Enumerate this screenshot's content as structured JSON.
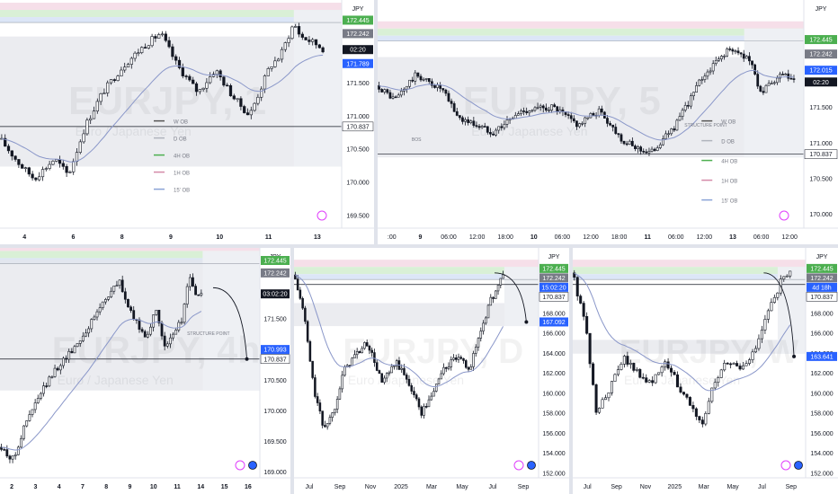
{
  "colors": {
    "up": "#131722",
    "down": "#131722",
    "ema": "#8a97c9",
    "zone": "#e4e6eb",
    "green_band": "#d9f0d6",
    "blue_band": "#dce6f7",
    "pink_band": "#f6dfe9",
    "price_green": "#4caf50",
    "price_gray": "#787b86",
    "price_blue": "#2962ff",
    "price_black": "#131722"
  },
  "panes": [
    {
      "id": "pane-top-left",
      "chart_data": {
        "type": "candlestick",
        "symbol": "JPY",
        "watermark_symbol": "EURJPY, 1",
        "watermark_name": "Euro / Japanese Yen",
        "ylim": [
          169.3,
          172.75
        ],
        "y_ticks": [
          "169.500",
          "170.000",
          "170.500",
          "171.000",
          "171.500"
        ],
        "x_ticks": [
          "4",
          "6",
          "8",
          "9",
          "10",
          "11",
          "13"
        ],
        "price_labels": [
          {
            "text": "172.445",
            "value": 172.445,
            "kind": "green"
          },
          {
            "text": "172.242",
            "value": 172.242,
            "kind": "gray"
          },
          {
            "text": "02:20",
            "value": 172.0,
            "kind": "black"
          },
          {
            "text": "171.789",
            "value": 171.789,
            "kind": "blue"
          },
          {
            "text": "170.837",
            "value": 170.837,
            "kind": "white"
          }
        ],
        "legend": [
          "W OB",
          "D OB",
          "4H OB",
          "1H OB",
          "15' OB"
        ],
        "path": [
          [
            0,
            170.65
          ],
          [
            0.06,
            170.25
          ],
          [
            0.1,
            170.05
          ],
          [
            0.16,
            170.35
          ],
          [
            0.2,
            170.1
          ],
          [
            0.25,
            170.85
          ],
          [
            0.3,
            171.35
          ],
          [
            0.36,
            171.75
          ],
          [
            0.42,
            172.05
          ],
          [
            0.47,
            172.25
          ],
          [
            0.52,
            171.75
          ],
          [
            0.58,
            171.35
          ],
          [
            0.63,
            171.7
          ],
          [
            0.68,
            171.3
          ],
          [
            0.73,
            171.0
          ],
          [
            0.79,
            171.75
          ],
          [
            0.82,
            171.9
          ],
          [
            0.86,
            172.4
          ],
          [
            0.88,
            172.2
          ],
          [
            0.92,
            172.1
          ],
          [
            0.95,
            172.0
          ]
        ]
      }
    },
    {
      "id": "pane-top-right",
      "chart_data": {
        "type": "candlestick",
        "symbol": "JPY",
        "watermark_symbol": "EURJPY, 5",
        "watermark_name": "Euro / Japanese Yen",
        "ylim": [
          169.8,
          173.0
        ],
        "y_ticks": [
          "170.000",
          "170.500",
          "171.000",
          "171.500"
        ],
        "x_ticks": [
          ":00",
          "9",
          "06:00",
          "12:00",
          "18:00",
          "10",
          "06:00",
          "12:00",
          "18:00",
          "11",
          "06:00",
          "12:00",
          "13",
          "06:00",
          "12:00"
        ],
        "price_labels": [
          {
            "text": "172.445",
            "value": 172.445,
            "kind": "green"
          },
          {
            "text": "172.242",
            "value": 172.242,
            "kind": "gray"
          },
          {
            "text": "172.015",
            "value": 172.015,
            "kind": "blue"
          },
          {
            "text": "02:20",
            "value": 171.85,
            "kind": "black"
          },
          {
            "text": "170.837",
            "value": 170.837,
            "kind": "white"
          }
        ],
        "legend": [
          "W OB",
          "D OB",
          "4H OB",
          "1H OB",
          "15' OB"
        ],
        "annotations": [
          "BOS",
          "STRUCTURE POINT"
        ],
        "path": [
          [
            0,
            171.8
          ],
          [
            0.04,
            171.6
          ],
          [
            0.09,
            171.95
          ],
          [
            0.15,
            171.75
          ],
          [
            0.19,
            171.35
          ],
          [
            0.27,
            171.15
          ],
          [
            0.34,
            171.45
          ],
          [
            0.41,
            171.5
          ],
          [
            0.47,
            171.25
          ],
          [
            0.52,
            171.45
          ],
          [
            0.58,
            171.0
          ],
          [
            0.64,
            170.85
          ],
          [
            0.7,
            171.25
          ],
          [
            0.76,
            171.9
          ],
          [
            0.82,
            172.3
          ],
          [
            0.87,
            172.2
          ],
          [
            0.9,
            171.7
          ],
          [
            0.95,
            171.95
          ],
          [
            0.98,
            171.85
          ]
        ]
      }
    },
    {
      "id": "pane-bottom-left",
      "chart_data": {
        "type": "candlestick",
        "symbol": "JPY",
        "watermark_symbol": "EURJPY, 4h",
        "watermark_name": "Euro / Japanese Yen",
        "ylim": [
          168.9,
          172.65
        ],
        "y_ticks": [
          "169.000",
          "169.500",
          "170.000",
          "170.500",
          "171.000",
          "171.500"
        ],
        "x_ticks": [
          "2",
          "3",
          "4",
          "7",
          "8",
          "9",
          "10",
          "11",
          "14",
          "15",
          "16"
        ],
        "price_labels": [
          {
            "text": "172.445",
            "value": 172.445,
            "kind": "green"
          },
          {
            "text": "172.242",
            "value": 172.242,
            "kind": "gray"
          },
          {
            "text": "03:02:20",
            "value": 171.9,
            "kind": "black"
          },
          {
            "text": "170.993",
            "value": 170.993,
            "kind": "blue"
          },
          {
            "text": "170.837",
            "value": 170.837,
            "kind": "white"
          }
        ],
        "annotations": [
          "STRUCTURE POINT"
        ],
        "path": [
          [
            0,
            169.4
          ],
          [
            0.05,
            169.2
          ],
          [
            0.1,
            169.8
          ],
          [
            0.16,
            170.3
          ],
          [
            0.22,
            170.7
          ],
          [
            0.28,
            171.0
          ],
          [
            0.34,
            171.35
          ],
          [
            0.4,
            171.8
          ],
          [
            0.46,
            172.1
          ],
          [
            0.5,
            171.6
          ],
          [
            0.56,
            171.2
          ],
          [
            0.6,
            171.6
          ],
          [
            0.64,
            171.0
          ],
          [
            0.7,
            171.5
          ],
          [
            0.73,
            172.2
          ],
          [
            0.76,
            171.8
          ],
          [
            0.78,
            172.0
          ]
        ]
      }
    },
    {
      "id": "pane-bottom-middle",
      "chart_data": {
        "type": "candlestick",
        "symbol": "JPY",
        "watermark_symbol": "EURJPY, D",
        "watermark_name": "Euro / Japanese Yen",
        "ylim": [
          151.5,
          174.5
        ],
        "y_ticks": [
          "152.000",
          "154.000",
          "156.000",
          "158.000",
          "160.000",
          "162.000",
          "164.000",
          "166.000",
          "168.000"
        ],
        "x_ticks": [
          "Jul",
          "Sep",
          "Nov",
          "2025",
          "Mar",
          "May",
          "Jul",
          "Sep"
        ],
        "price_labels": [
          {
            "text": "172.445",
            "value": 172.445,
            "kind": "green"
          },
          {
            "text": "172.242",
            "value": 172.242,
            "kind": "gray"
          },
          {
            "text": "15:02:20",
            "value": 171.4,
            "kind": "blue"
          },
          {
            "text": "170.837",
            "value": 170.837,
            "kind": "white"
          },
          {
            "text": "167.092",
            "value": 167.092,
            "kind": "blue"
          }
        ],
        "path": [
          [
            0,
            171.8
          ],
          [
            0.04,
            168.0
          ],
          [
            0.08,
            160.5
          ],
          [
            0.12,
            156.5
          ],
          [
            0.16,
            158.0
          ],
          [
            0.2,
            162.0
          ],
          [
            0.24,
            163.5
          ],
          [
            0.3,
            165.0
          ],
          [
            0.36,
            161.0
          ],
          [
            0.42,
            163.0
          ],
          [
            0.48,
            160.5
          ],
          [
            0.52,
            158.0
          ],
          [
            0.56,
            159.5
          ],
          [
            0.6,
            162.0
          ],
          [
            0.66,
            163.5
          ],
          [
            0.72,
            162.5
          ],
          [
            0.76,
            166.0
          ],
          [
            0.8,
            169.0
          ],
          [
            0.84,
            171.0
          ],
          [
            0.86,
            172.0
          ]
        ]
      }
    },
    {
      "id": "pane-bottom-right",
      "chart_data": {
        "type": "candlestick",
        "symbol": "JPY",
        "watermark_symbol": "EURJPY, W",
        "watermark_name": "Euro / Japanese Yen",
        "ylim": [
          151.5,
          174.5
        ],
        "y_ticks": [
          "152.000",
          "154.000",
          "156.000",
          "158.000",
          "160.000",
          "162.000",
          "164.000",
          "166.000",
          "168.000"
        ],
        "x_ticks": [
          "Jul",
          "Sep",
          "Nov",
          "2025",
          "Mar",
          "May",
          "Jul",
          "Sep"
        ],
        "price_labels": [
          {
            "text": "172.445",
            "value": 172.445,
            "kind": "green"
          },
          {
            "text": "172.242",
            "value": 172.242,
            "kind": "gray"
          },
          {
            "text": "4d 18h",
            "value": 171.5,
            "kind": "blue"
          },
          {
            "text": "170.837",
            "value": 170.837,
            "kind": "white"
          },
          {
            "text": "163.641",
            "value": 163.641,
            "kind": "blue"
          }
        ],
        "path": [
          [
            0,
            172.0
          ],
          [
            0.06,
            166.0
          ],
          [
            0.1,
            158.0
          ],
          [
            0.16,
            160.5
          ],
          [
            0.22,
            163.5
          ],
          [
            0.28,
            162.0
          ],
          [
            0.34,
            161.0
          ],
          [
            0.4,
            163.0
          ],
          [
            0.46,
            160.5
          ],
          [
            0.52,
            158.0
          ],
          [
            0.56,
            157.0
          ],
          [
            0.6,
            160.5
          ],
          [
            0.66,
            163.0
          ],
          [
            0.72,
            162.5
          ],
          [
            0.78,
            164.0
          ],
          [
            0.84,
            168.0
          ],
          [
            0.9,
            171.5
          ],
          [
            0.94,
            172.0
          ]
        ]
      }
    }
  ]
}
